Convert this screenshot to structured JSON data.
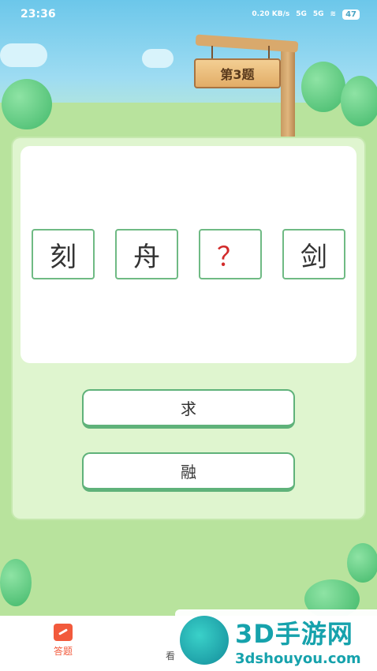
{
  "status_bar": {
    "time": "23:36",
    "net_speed": "0.20 KB/s",
    "signal1": "5G",
    "signal2": "5G",
    "battery": "47"
  },
  "sign": {
    "label": "第3题"
  },
  "question": {
    "chars": [
      "刻",
      "舟",
      "？",
      "剑"
    ]
  },
  "options": [
    {
      "label": "求"
    },
    {
      "label": "融"
    }
  ],
  "tabbar": {
    "tabs": [
      {
        "label": "答题",
        "color": "#f25a3c"
      },
      {
        "label": "看"
      }
    ]
  },
  "watermark": {
    "title": "3D手游网",
    "url": "3dshouyou.com"
  }
}
